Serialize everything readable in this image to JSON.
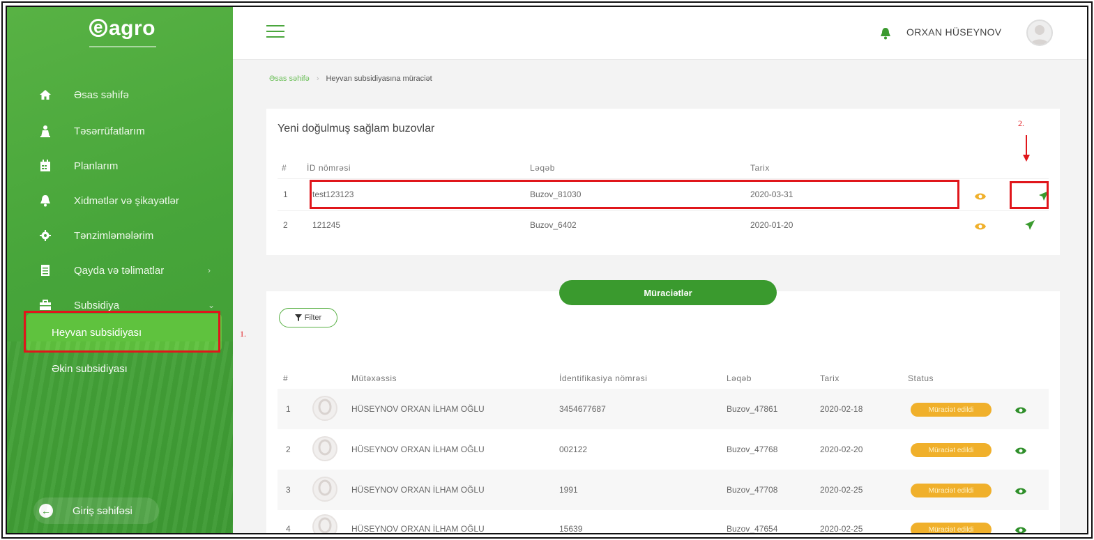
{
  "sidebar": {
    "logo": "agro",
    "logo_e": "e",
    "items": [
      {
        "label": "Əsas səhifə",
        "icon": "home-icon"
      },
      {
        "label": "Təsərrüfatlarım",
        "icon": "farmer-icon"
      },
      {
        "label": "Planlarım",
        "icon": "calendar-icon"
      },
      {
        "label": "Xidmətlər və şikayətlər",
        "icon": "bell-icon"
      },
      {
        "label": "Tənzimləmələrim",
        "icon": "gear-icon"
      },
      {
        "label": "Qayda və təlimatlar",
        "icon": "document-icon",
        "chevron": "›"
      },
      {
        "label": "Subsidiya",
        "icon": "briefcase-icon",
        "chevron": "⌄"
      }
    ],
    "subitems": [
      {
        "label": "Heyvan subsidiyası",
        "active": true
      },
      {
        "label": "Əkin subsidiyası",
        "active": false
      }
    ],
    "login_label": "Giriş səhifəsi"
  },
  "topbar": {
    "username": "ORXAN HÜSEYNOV"
  },
  "breadcrumb": {
    "home": "Əsas səhifə",
    "current": "Heyvan subsidiyasına müraciət"
  },
  "annotations": {
    "step1": "1.",
    "step2": "2."
  },
  "calves": {
    "title": "Yeni doğulmuş sağlam buzovlar",
    "headers": {
      "num": "#",
      "id": "İD nömrəsi",
      "name": "Ləqəb",
      "date": "Tarix"
    },
    "rows": [
      {
        "num": "1",
        "id": "test123123",
        "name": "Buzov_81030",
        "date": "2020-03-31"
      },
      {
        "num": "2",
        "id": "121245",
        "name": "Buzov_6402",
        "date": "2020-01-20"
      }
    ]
  },
  "applications": {
    "tab_label": "Müraciətlər",
    "filter_label": "Filter",
    "headers": {
      "num": "#",
      "specialist": "Mütəxəssis",
      "ident": "İdentifikasiya nömrəsi",
      "name": "Ləqəb",
      "date": "Tarix",
      "status": "Status"
    },
    "rows": [
      {
        "num": "1",
        "specialist": "HÜSEYNOV ORXAN İLHAM OĞLU",
        "ident": "3454677687",
        "name": "Buzov_47861",
        "date": "2020-02-18",
        "status": "Müraciət edildi"
      },
      {
        "num": "2",
        "specialist": "HÜSEYNOV ORXAN İLHAM OĞLU",
        "ident": "002122",
        "name": "Buzov_47768",
        "date": "2020-02-20",
        "status": "Müraciət edildi"
      },
      {
        "num": "3",
        "specialist": "HÜSEYNOV ORXAN İLHAM OĞLU",
        "ident": "1991",
        "name": "Buzov_47708",
        "date": "2020-02-25",
        "status": "Müraciət edildi"
      },
      {
        "num": "4",
        "specialist": "HÜSEYNOV ORXAN İLHAM OĞLU",
        "ident": "15639",
        "name": "Buzov_47654",
        "date": "2020-02-25",
        "status": "Müraciət edildi"
      }
    ]
  },
  "colors": {
    "brand_green": "#4aa63d",
    "status_orange": "#f0b02b",
    "highlight_red": "#e0161b"
  }
}
